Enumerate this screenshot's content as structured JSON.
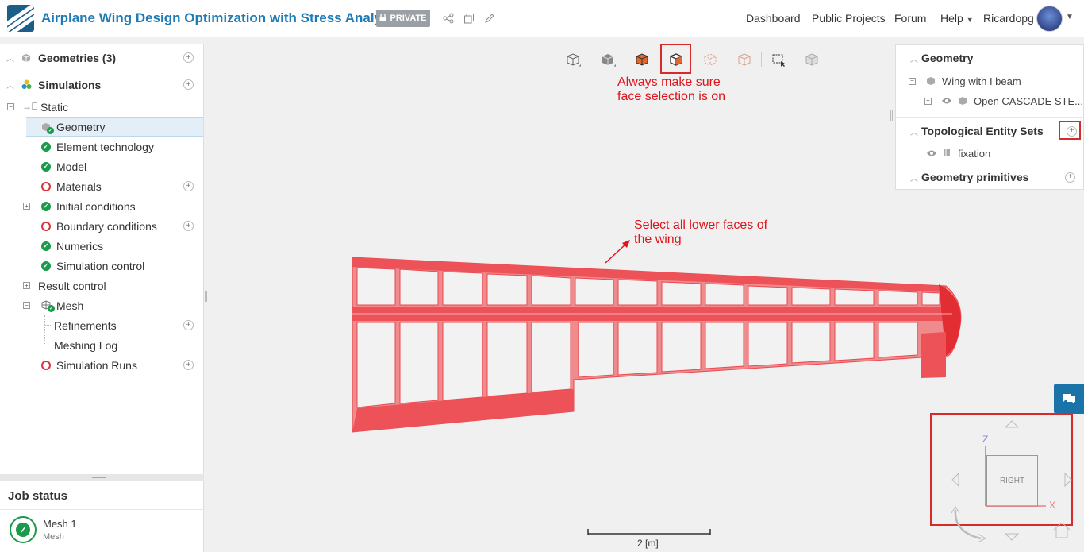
{
  "header": {
    "title": "Airplane Wing Design Optimization with Stress Analysis",
    "private_badge": "PRIVATE",
    "nav": {
      "dashboard": "Dashboard",
      "public_projects": "Public Projects",
      "forum": "Forum",
      "help": "Help",
      "user": "Ricardopg"
    }
  },
  "tree": {
    "geometries": "Geometries (3)",
    "simulations": "Simulations",
    "static": "Static",
    "geometry": "Geometry",
    "element_technology": "Element technology",
    "model": "Model",
    "materials": "Materials",
    "initial_conditions": "Initial conditions",
    "boundary_conditions": "Boundary conditions",
    "numerics": "Numerics",
    "simulation_control": "Simulation control",
    "result_control": "Result control",
    "mesh": "Mesh",
    "refinements": "Refinements",
    "meshing_log": "Meshing Log",
    "simulation_runs": "Simulation Runs"
  },
  "job_status": {
    "title": "Job status",
    "job_name": "Mesh 1",
    "job_type": "Mesh"
  },
  "right_panel": {
    "geometry_title": "Geometry",
    "wing": "Wing with I beam",
    "cascade": "Open CASCADE STE...",
    "topo_title": "Topological Entity Sets",
    "fixation": "fixation",
    "primitives_title": "Geometry primitives"
  },
  "annotations": {
    "face_selection_line1": "Always make sure",
    "face_selection_line2": "face selection is on",
    "lower_faces_line1": "Select all lower faces of",
    "lower_faces_line2": "the wing"
  },
  "viewer": {
    "scale_label": "2 [m]",
    "view_cube_label": "RIGHT",
    "axis_z": "Z",
    "axis_x": "X"
  },
  "colors": {
    "brand": "#1f7bb6",
    "selection_red": "#ec5257",
    "annotation_red": "#e0141b",
    "ok_green": "#1a9a4c",
    "error_red": "#d9303a"
  }
}
